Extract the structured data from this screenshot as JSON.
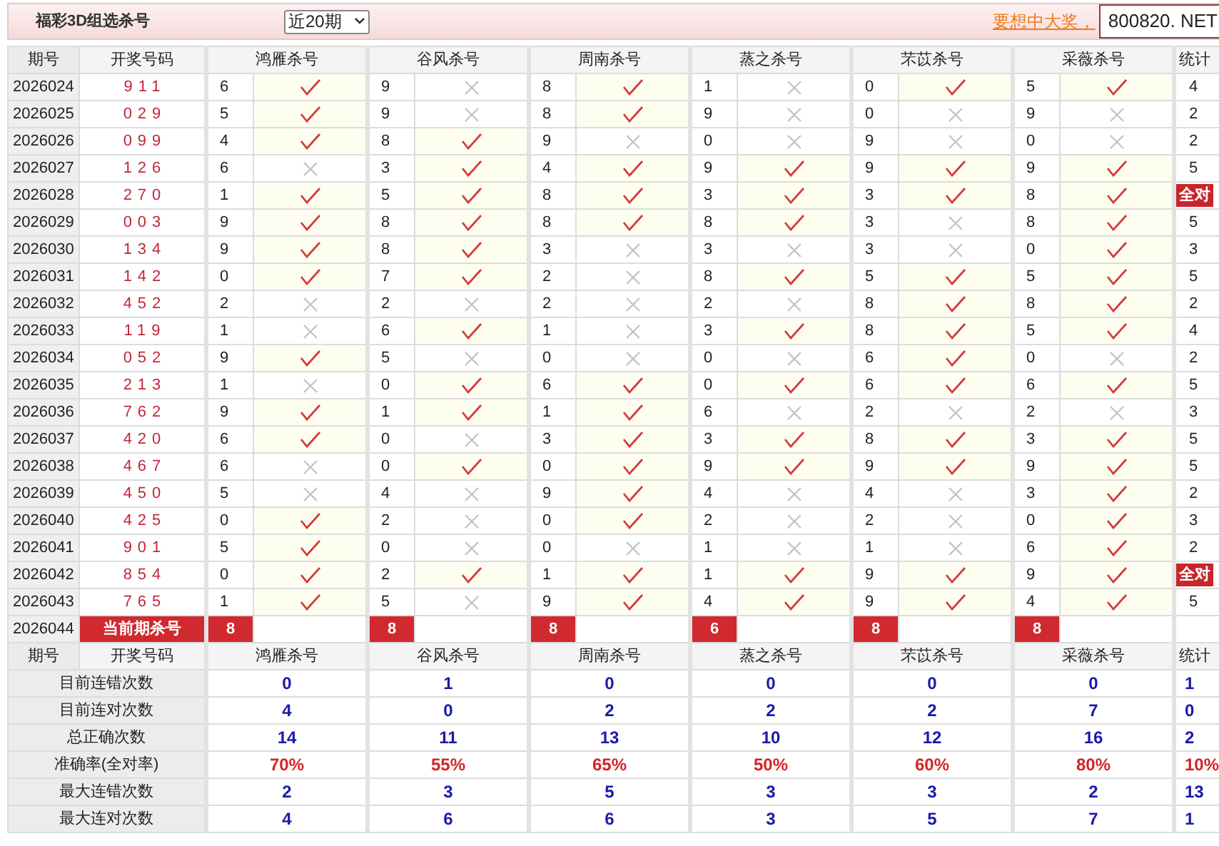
{
  "header": {
    "title": "福彩3D组选杀号",
    "range_select": "近20期",
    "promo_link": "要想中大奖，",
    "site_badge": "800820. NET"
  },
  "columns": [
    "期号",
    "开奖号码",
    "鸿雁杀号",
    "谷风杀号",
    "周南杀号",
    "蒸之杀号",
    "芣苡杀号",
    "采薇杀号",
    "统计"
  ],
  "rows": [
    {
      "period": "2026024",
      "draw": "911",
      "picks": [
        {
          "number": "6",
          "ok": true
        },
        {
          "number": "9",
          "ok": false
        },
        {
          "number": "8",
          "ok": true
        },
        {
          "number": "1",
          "ok": false
        },
        {
          "number": "0",
          "ok": true
        },
        {
          "number": "5",
          "ok": true
        }
      ],
      "stat": "4",
      "kind": "plain"
    },
    {
      "period": "2026025",
      "draw": "029",
      "picks": [
        {
          "number": "5",
          "ok": true
        },
        {
          "number": "9",
          "ok": false
        },
        {
          "number": "8",
          "ok": true
        },
        {
          "number": "9",
          "ok": false
        },
        {
          "number": "0",
          "ok": false
        },
        {
          "number": "9",
          "ok": false
        }
      ],
      "stat": "2",
      "kind": "plain"
    },
    {
      "period": "2026026",
      "draw": "099",
      "picks": [
        {
          "number": "4",
          "ok": true
        },
        {
          "number": "8",
          "ok": true
        },
        {
          "number": "9",
          "ok": false
        },
        {
          "number": "0",
          "ok": false
        },
        {
          "number": "9",
          "ok": false
        },
        {
          "number": "0",
          "ok": false
        }
      ],
      "stat": "2",
      "kind": "plain"
    },
    {
      "period": "2026027",
      "draw": "126",
      "picks": [
        {
          "number": "6",
          "ok": false
        },
        {
          "number": "3",
          "ok": true
        },
        {
          "number": "4",
          "ok": true
        },
        {
          "number": "9",
          "ok": true
        },
        {
          "number": "9",
          "ok": true
        },
        {
          "number": "9",
          "ok": true
        }
      ],
      "stat": "5",
      "kind": "plain"
    },
    {
      "period": "2026028",
      "draw": "270",
      "picks": [
        {
          "number": "1",
          "ok": true
        },
        {
          "number": "5",
          "ok": true
        },
        {
          "number": "8",
          "ok": true
        },
        {
          "number": "3",
          "ok": true
        },
        {
          "number": "3",
          "ok": true
        },
        {
          "number": "8",
          "ok": true
        }
      ],
      "stat": "全对",
      "kind": "badge"
    },
    {
      "period": "2026029",
      "draw": "003",
      "picks": [
        {
          "number": "9",
          "ok": true
        },
        {
          "number": "8",
          "ok": true
        },
        {
          "number": "8",
          "ok": true
        },
        {
          "number": "8",
          "ok": true
        },
        {
          "number": "3",
          "ok": false
        },
        {
          "number": "8",
          "ok": true
        }
      ],
      "stat": "5",
      "kind": "plain"
    },
    {
      "period": "2026030",
      "draw": "134",
      "picks": [
        {
          "number": "9",
          "ok": true
        },
        {
          "number": "8",
          "ok": true
        },
        {
          "number": "3",
          "ok": false
        },
        {
          "number": "3",
          "ok": false
        },
        {
          "number": "3",
          "ok": false
        },
        {
          "number": "0",
          "ok": true
        }
      ],
      "stat": "3",
      "kind": "plain"
    },
    {
      "period": "2026031",
      "draw": "142",
      "picks": [
        {
          "number": "0",
          "ok": true
        },
        {
          "number": "7",
          "ok": true
        },
        {
          "number": "2",
          "ok": false
        },
        {
          "number": "8",
          "ok": true
        },
        {
          "number": "5",
          "ok": true
        },
        {
          "number": "5",
          "ok": true
        }
      ],
      "stat": "5",
      "kind": "plain"
    },
    {
      "period": "2026032",
      "draw": "452",
      "picks": [
        {
          "number": "2",
          "ok": false
        },
        {
          "number": "2",
          "ok": false
        },
        {
          "number": "2",
          "ok": false
        },
        {
          "number": "2",
          "ok": false
        },
        {
          "number": "8",
          "ok": true
        },
        {
          "number": "8",
          "ok": true
        }
      ],
      "stat": "2",
      "kind": "plain"
    },
    {
      "period": "2026033",
      "draw": "119",
      "picks": [
        {
          "number": "1",
          "ok": false
        },
        {
          "number": "6",
          "ok": true
        },
        {
          "number": "1",
          "ok": false
        },
        {
          "number": "3",
          "ok": true
        },
        {
          "number": "8",
          "ok": true
        },
        {
          "number": "5",
          "ok": true
        }
      ],
      "stat": "4",
      "kind": "plain"
    },
    {
      "period": "2026034",
      "draw": "052",
      "picks": [
        {
          "number": "9",
          "ok": true
        },
        {
          "number": "5",
          "ok": false
        },
        {
          "number": "0",
          "ok": false
        },
        {
          "number": "0",
          "ok": false
        },
        {
          "number": "6",
          "ok": true
        },
        {
          "number": "0",
          "ok": false
        }
      ],
      "stat": "2",
      "kind": "plain"
    },
    {
      "period": "2026035",
      "draw": "213",
      "picks": [
        {
          "number": "1",
          "ok": false
        },
        {
          "number": "0",
          "ok": true
        },
        {
          "number": "6",
          "ok": true
        },
        {
          "number": "0",
          "ok": true
        },
        {
          "number": "6",
          "ok": true
        },
        {
          "number": "6",
          "ok": true
        }
      ],
      "stat": "5",
      "kind": "plain"
    },
    {
      "period": "2026036",
      "draw": "762",
      "picks": [
        {
          "number": "9",
          "ok": true
        },
        {
          "number": "1",
          "ok": true
        },
        {
          "number": "1",
          "ok": true
        },
        {
          "number": "6",
          "ok": false
        },
        {
          "number": "2",
          "ok": false
        },
        {
          "number": "2",
          "ok": false
        }
      ],
      "stat": "3",
      "kind": "plain"
    },
    {
      "period": "2026037",
      "draw": "420",
      "picks": [
        {
          "number": "6",
          "ok": true
        },
        {
          "number": "0",
          "ok": false
        },
        {
          "number": "3",
          "ok": true
        },
        {
          "number": "3",
          "ok": true
        },
        {
          "number": "8",
          "ok": true
        },
        {
          "number": "3",
          "ok": true
        }
      ],
      "stat": "5",
      "kind": "plain"
    },
    {
      "period": "2026038",
      "draw": "467",
      "picks": [
        {
          "number": "6",
          "ok": false
        },
        {
          "number": "0",
          "ok": true
        },
        {
          "number": "0",
          "ok": true
        },
        {
          "number": "9",
          "ok": true
        },
        {
          "number": "9",
          "ok": true
        },
        {
          "number": "9",
          "ok": true
        }
      ],
      "stat": "5",
      "kind": "plain"
    },
    {
      "period": "2026039",
      "draw": "450",
      "picks": [
        {
          "number": "5",
          "ok": false
        },
        {
          "number": "4",
          "ok": false
        },
        {
          "number": "9",
          "ok": true
        },
        {
          "number": "4",
          "ok": false
        },
        {
          "number": "4",
          "ok": false
        },
        {
          "number": "3",
          "ok": true
        }
      ],
      "stat": "2",
      "kind": "plain"
    },
    {
      "period": "2026040",
      "draw": "425",
      "picks": [
        {
          "number": "0",
          "ok": true
        },
        {
          "number": "2",
          "ok": false
        },
        {
          "number": "0",
          "ok": true
        },
        {
          "number": "2",
          "ok": false
        },
        {
          "number": "2",
          "ok": false
        },
        {
          "number": "0",
          "ok": true
        }
      ],
      "stat": "3",
      "kind": "plain"
    },
    {
      "period": "2026041",
      "draw": "901",
      "picks": [
        {
          "number": "5",
          "ok": true
        },
        {
          "number": "0",
          "ok": false
        },
        {
          "number": "0",
          "ok": false
        },
        {
          "number": "1",
          "ok": false
        },
        {
          "number": "1",
          "ok": false
        },
        {
          "number": "6",
          "ok": true
        }
      ],
      "stat": "2",
      "kind": "plain"
    },
    {
      "period": "2026042",
      "draw": "854",
      "picks": [
        {
          "number": "0",
          "ok": true
        },
        {
          "number": "2",
          "ok": true
        },
        {
          "number": "1",
          "ok": true
        },
        {
          "number": "1",
          "ok": true
        },
        {
          "number": "9",
          "ok": true
        },
        {
          "number": "9",
          "ok": true
        }
      ],
      "stat": "全对",
      "kind": "badge"
    },
    {
      "period": "2026043",
      "draw": "765",
      "picks": [
        {
          "number": "1",
          "ok": true
        },
        {
          "number": "5",
          "ok": false
        },
        {
          "number": "9",
          "ok": true
        },
        {
          "number": "4",
          "ok": true
        },
        {
          "number": "9",
          "ok": true
        },
        {
          "number": "4",
          "ok": true
        }
      ],
      "stat": "5",
      "kind": "plain"
    }
  ],
  "current": {
    "period": "2026044",
    "label": "当前期杀号",
    "picks": [
      "8",
      "8",
      "8",
      "6",
      "8",
      "8"
    ]
  },
  "footer_columns": [
    "期号",
    "开奖号码",
    "鸿雁杀号",
    "谷风杀号",
    "周南杀号",
    "蒸之杀号",
    "芣苡杀号",
    "采薇杀号",
    "统计"
  ],
  "stats": [
    {
      "label": "目前连错次数",
      "kind": "count",
      "values": [
        "0",
        "1",
        "0",
        "0",
        "0",
        "0"
      ],
      "stat": "1"
    },
    {
      "label": "目前连对次数",
      "kind": "count",
      "values": [
        "4",
        "0",
        "2",
        "2",
        "2",
        "7"
      ],
      "stat": "0"
    },
    {
      "label": "总正确次数",
      "kind": "count",
      "values": [
        "14",
        "11",
        "13",
        "10",
        "12",
        "16"
      ],
      "stat": "2"
    },
    {
      "label": "准确率(全对率)",
      "kind": "rate",
      "values": [
        "70%",
        "55%",
        "65%",
        "50%",
        "60%",
        "80%"
      ],
      "stat": "10%"
    },
    {
      "label": "最大连错次数",
      "kind": "count",
      "values": [
        "2",
        "3",
        "5",
        "3",
        "3",
        "2"
      ],
      "stat": "13"
    },
    {
      "label": "最大连对次数",
      "kind": "count",
      "values": [
        "4",
        "6",
        "6",
        "3",
        "5",
        "7"
      ],
      "stat": "1"
    }
  ]
}
